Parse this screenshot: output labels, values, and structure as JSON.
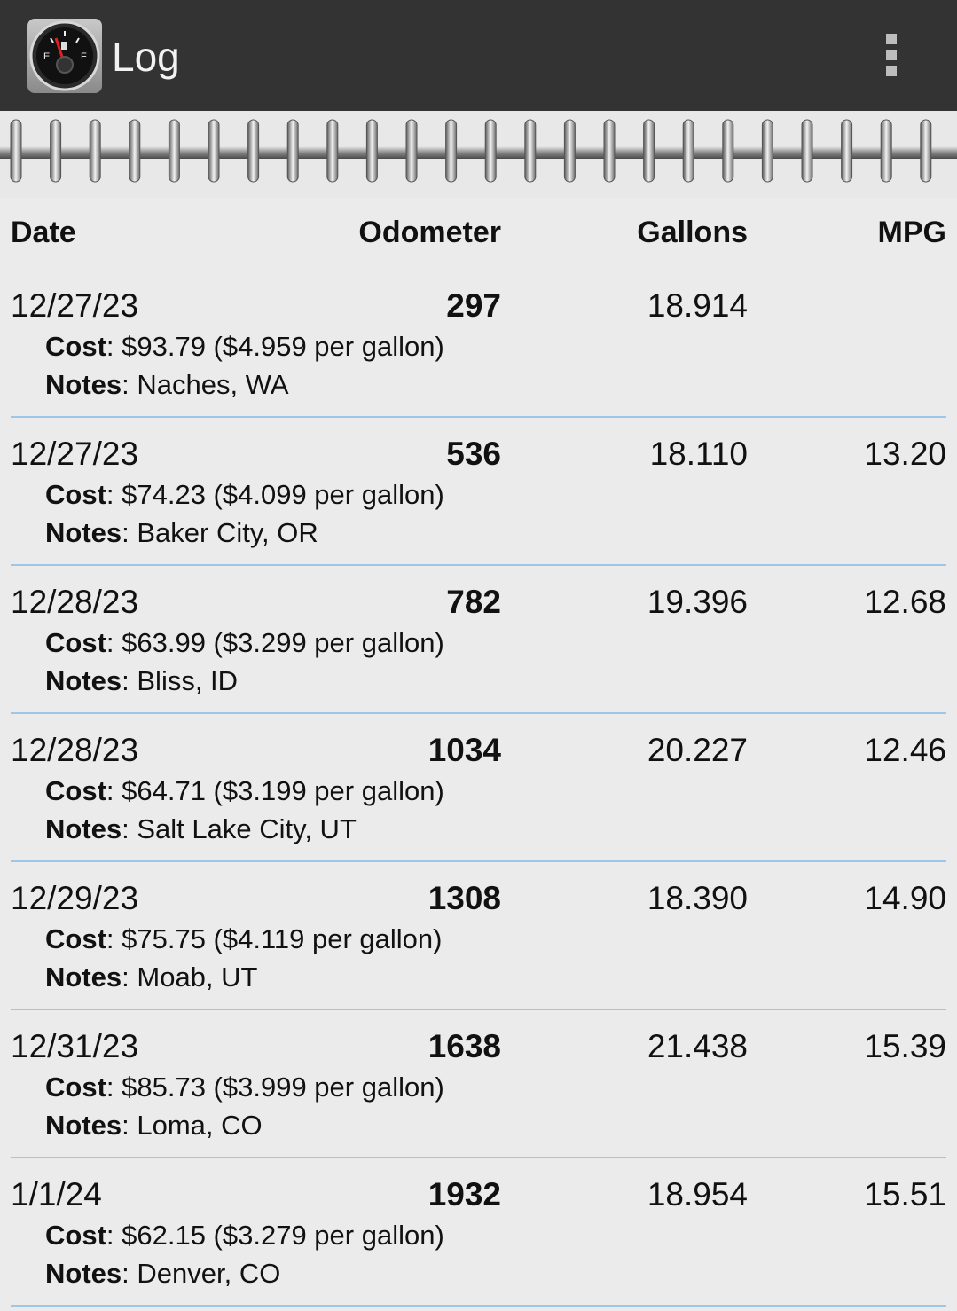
{
  "appbar": {
    "title": "Log",
    "icon": "fuel-gauge-icon",
    "menu_icon": "overflow-menu-icon"
  },
  "columns": {
    "date": "Date",
    "odometer": "Odometer",
    "gallons": "Gallons",
    "mpg": "MPG"
  },
  "labels": {
    "cost": "Cost",
    "notes": "Notes"
  },
  "entries": [
    {
      "date": "12/27/23",
      "odometer": "297",
      "gallons": "18.914",
      "mpg": "",
      "cost": "$93.79 ($4.959 per gallon)",
      "notes": "Naches, WA"
    },
    {
      "date": "12/27/23",
      "odometer": "536",
      "gallons": "18.110",
      "mpg": "13.20",
      "cost": "$74.23 ($4.099 per gallon)",
      "notes": "Baker City, OR"
    },
    {
      "date": "12/28/23",
      "odometer": "782",
      "gallons": "19.396",
      "mpg": "12.68",
      "cost": "$63.99 ($3.299 per gallon)",
      "notes": "Bliss, ID"
    },
    {
      "date": "12/28/23",
      "odometer": "1034",
      "gallons": "20.227",
      "mpg": "12.46",
      "cost": "$64.71 ($3.199 per gallon)",
      "notes": "Salt Lake City, UT"
    },
    {
      "date": "12/29/23",
      "odometer": "1308",
      "gallons": "18.390",
      "mpg": "14.90",
      "cost": "$75.75 ($4.119 per gallon)",
      "notes": "Moab, UT"
    },
    {
      "date": "12/31/23",
      "odometer": "1638",
      "gallons": "21.438",
      "mpg": "15.39",
      "cost": "$85.73 ($3.999 per gallon)",
      "notes": "Loma, CO"
    },
    {
      "date": "1/1/24",
      "odometer": "1932",
      "gallons": "18.954",
      "mpg": "15.51",
      "cost": "$62.15 ($3.279 per gallon)",
      "notes": "Denver, CO"
    }
  ],
  "colors": {
    "appbar": "#333333",
    "background": "#ebebeb",
    "divider": "#9ec6e8"
  }
}
